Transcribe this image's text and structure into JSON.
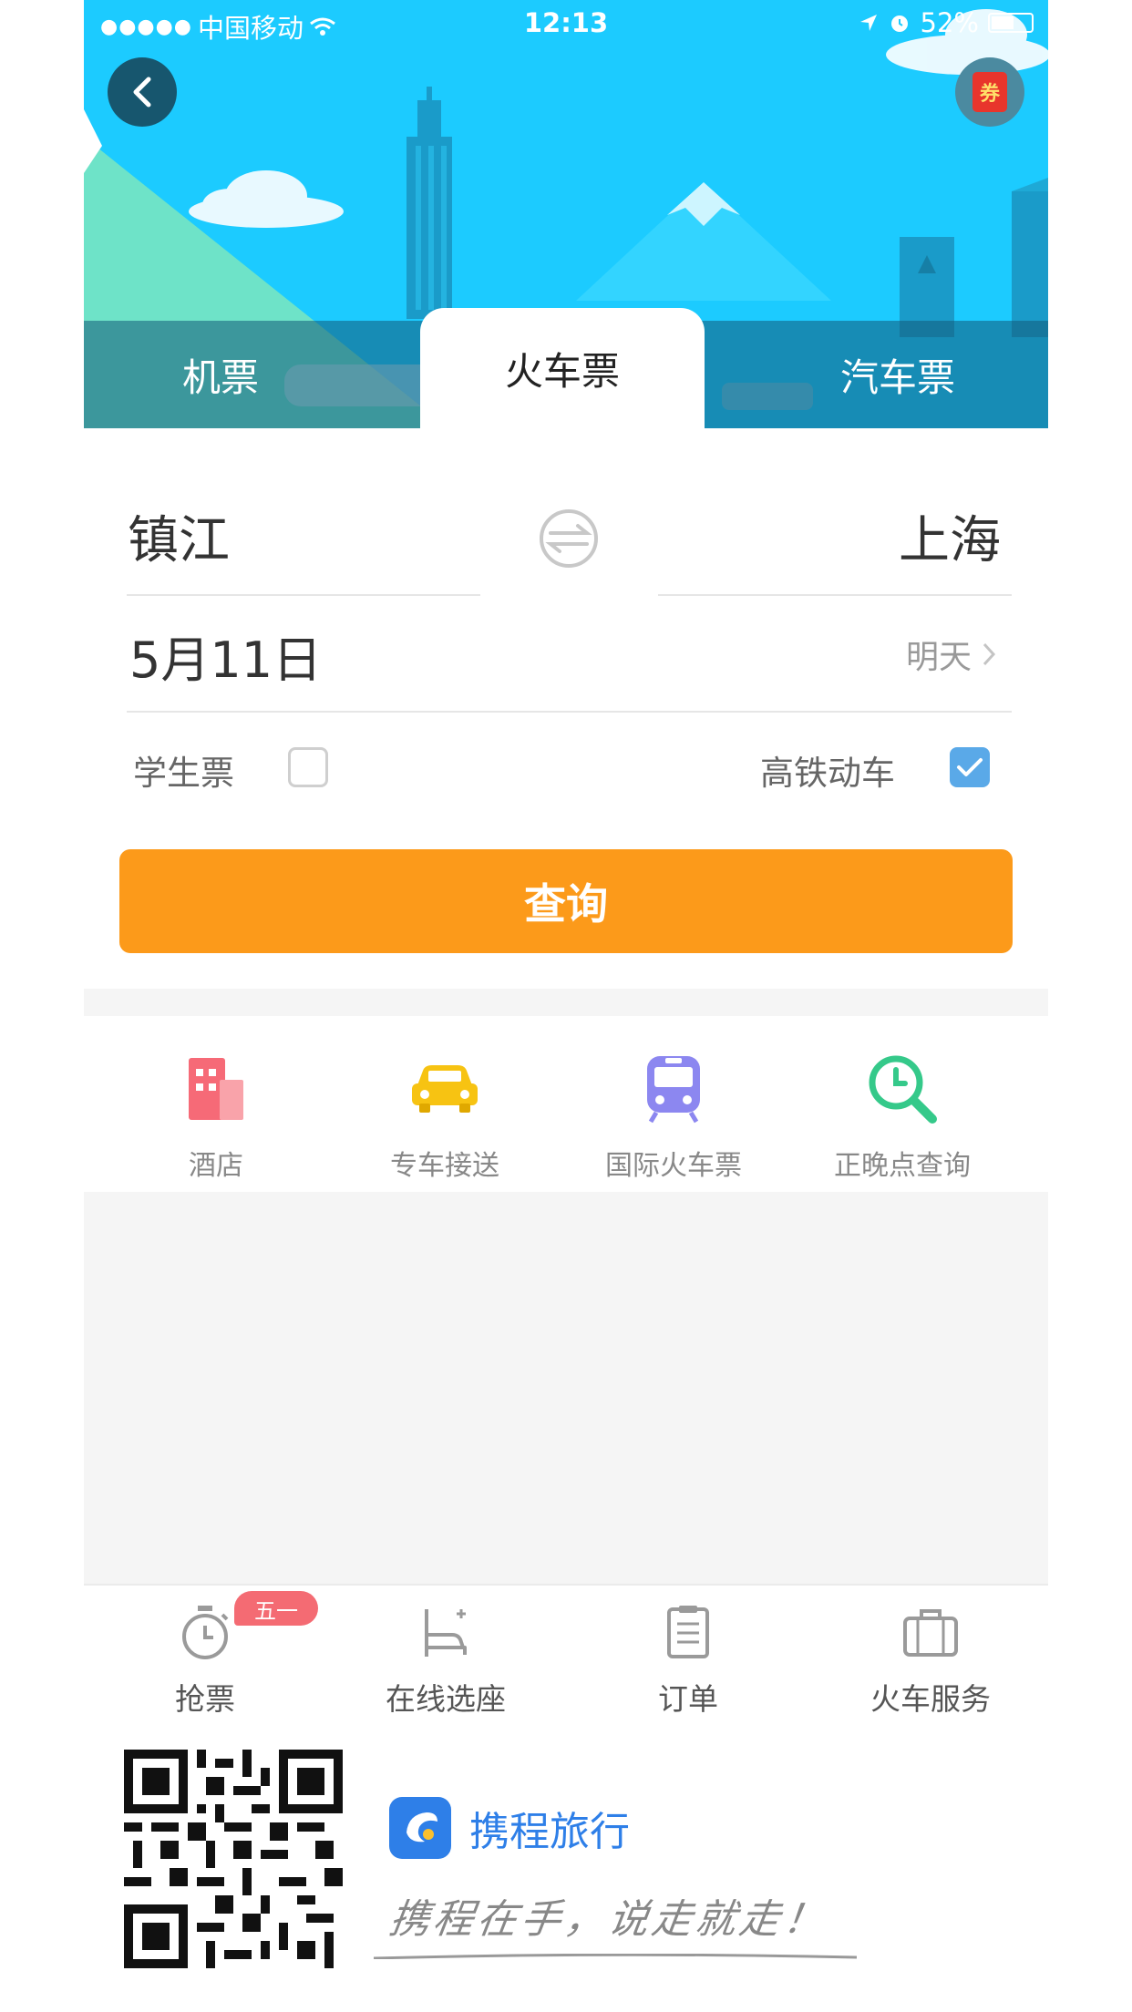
{
  "status_bar": {
    "carrier": "中国移动",
    "time": "12:13",
    "battery": "52%"
  },
  "header": {
    "coupon_label": "券",
    "tabs": [
      {
        "label": "机票",
        "active": false
      },
      {
        "label": "火车票",
        "active": true
      },
      {
        "label": "汽车票",
        "active": false
      }
    ]
  },
  "form": {
    "from_city": "镇江",
    "to_city": "上海",
    "date": "5月11日",
    "date_hint": "明天",
    "student_ticket": {
      "label": "学生票",
      "checked": false
    },
    "high_speed": {
      "label": "高铁动车",
      "checked": true
    },
    "search_label": "查询"
  },
  "quick_links": [
    {
      "label": "酒店",
      "icon": "hotel-icon",
      "color": "#f66a77"
    },
    {
      "label": "专车接送",
      "icon": "car-icon",
      "color": "#f7c312"
    },
    {
      "label": "国际火车票",
      "icon": "train-icon",
      "color": "#8c87f0"
    },
    {
      "label": "正晚点查询",
      "icon": "clock-search-icon",
      "color": "#35c98a"
    }
  ],
  "bottom_tabs": [
    {
      "label": "抢票",
      "icon": "stopwatch-icon",
      "badge": "五一"
    },
    {
      "label": "在线选座",
      "icon": "seat-icon"
    },
    {
      "label": "订单",
      "icon": "clipboard-icon"
    },
    {
      "label": "火车服务",
      "icon": "suitcase-icon"
    }
  ],
  "footer": {
    "brand_name": "携程旅行",
    "slogan": "携程在手，说走就走！"
  },
  "colors": {
    "header_sky": "#1ccbff",
    "search_button": "#fc9a1a",
    "checkbox_on": "#5aa9e8",
    "brand_blue": "#2e7fe8"
  }
}
